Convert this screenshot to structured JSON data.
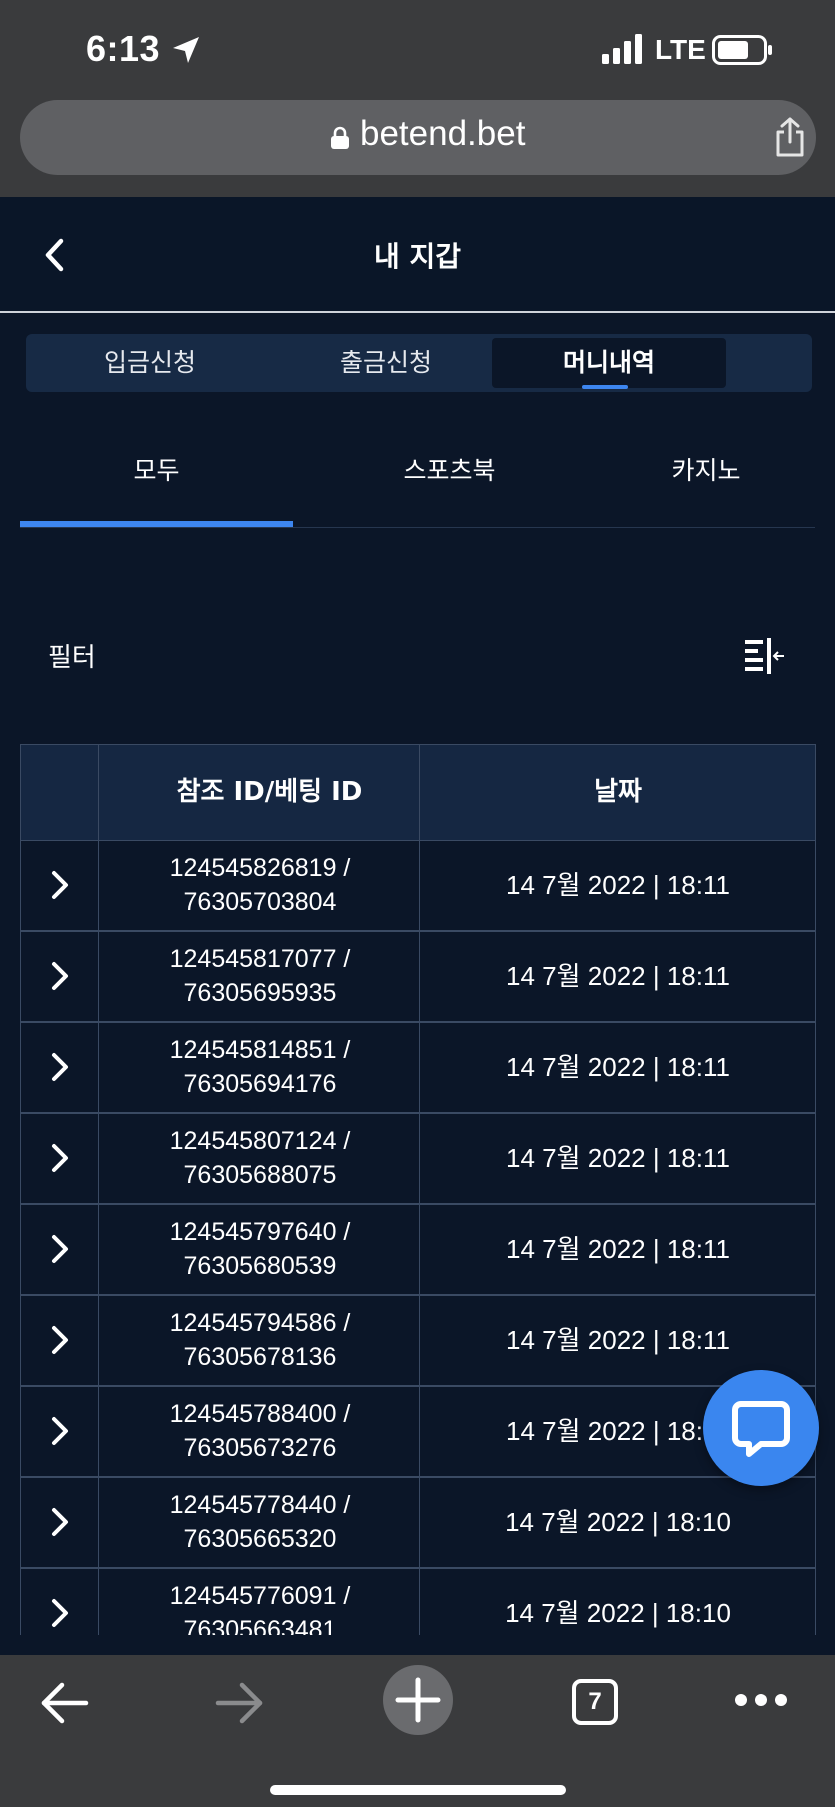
{
  "status_bar": {
    "time": "6:13",
    "network": "LTE"
  },
  "browser": {
    "url": "betend.bet",
    "tab_count": "7"
  },
  "header": {
    "title": "내 지갑"
  },
  "segments": [
    {
      "label": "입금신청",
      "active": false
    },
    {
      "label": "출금신청",
      "active": false
    },
    {
      "label": "머니내역",
      "active": true
    }
  ],
  "subtabs": [
    {
      "label": "모두",
      "active": true
    },
    {
      "label": "스포츠북",
      "active": false
    },
    {
      "label": "카지노",
      "active": false
    }
  ],
  "filter": {
    "label": "필터"
  },
  "table": {
    "headers": [
      "참조 ID/베팅 ID",
      "날짜"
    ],
    "rows": [
      {
        "ref": "124545826819 /",
        "bet": "76305703804",
        "date": "14 7월 2022 | 18:11"
      },
      {
        "ref": "124545817077 /",
        "bet": "76305695935",
        "date": "14 7월 2022 | 18:11"
      },
      {
        "ref": "124545814851 /",
        "bet": "76305694176",
        "date": "14 7월 2022 | 18:11"
      },
      {
        "ref": "124545807124 /",
        "bet": "76305688075",
        "date": "14 7월 2022 | 18:11"
      },
      {
        "ref": "124545797640 /",
        "bet": "76305680539",
        "date": "14 7월 2022 | 18:11"
      },
      {
        "ref": "124545794586 /",
        "bet": "76305678136",
        "date": "14 7월 2022 | 18:11"
      },
      {
        "ref": "124545788400 /",
        "bet": "76305673276",
        "date": "14 7월 2022 | 18:11"
      },
      {
        "ref": "124545778440 /",
        "bet": "76305665320",
        "date": "14 7월 2022 | 18:10"
      },
      {
        "ref": "124545776091 /",
        "bet": "76305663481",
        "date": "14 7월 2022 | 18:10"
      }
    ]
  },
  "icons": {
    "back": "chevron-left-icon",
    "filter": "filter-columns-icon",
    "row_expand": "chevron-right-icon",
    "chat": "chat-bubble-icon"
  },
  "colors": {
    "background": "#0b1628",
    "accent": "#3d86f0",
    "panel": "#172a45",
    "browser_chrome": "#3a3b3d"
  }
}
